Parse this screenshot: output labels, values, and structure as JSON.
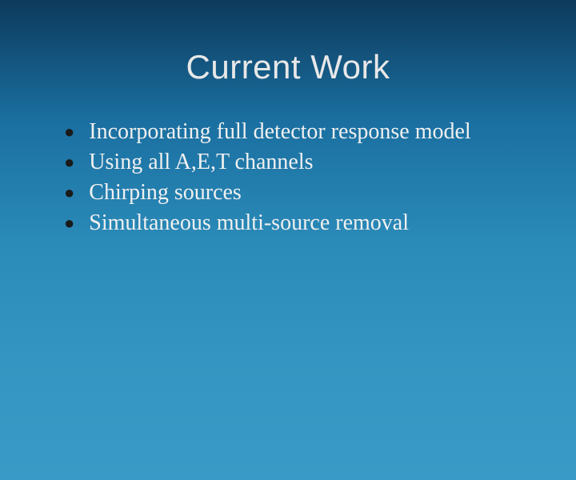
{
  "slide": {
    "title": "Current Work",
    "bullets": [
      {
        "text": "Incorporating full detector response model"
      },
      {
        "text": "Using all A,E,T channels"
      },
      {
        "text": "Chirping sources"
      },
      {
        "text": "Simultaneous multi-source removal"
      }
    ]
  }
}
